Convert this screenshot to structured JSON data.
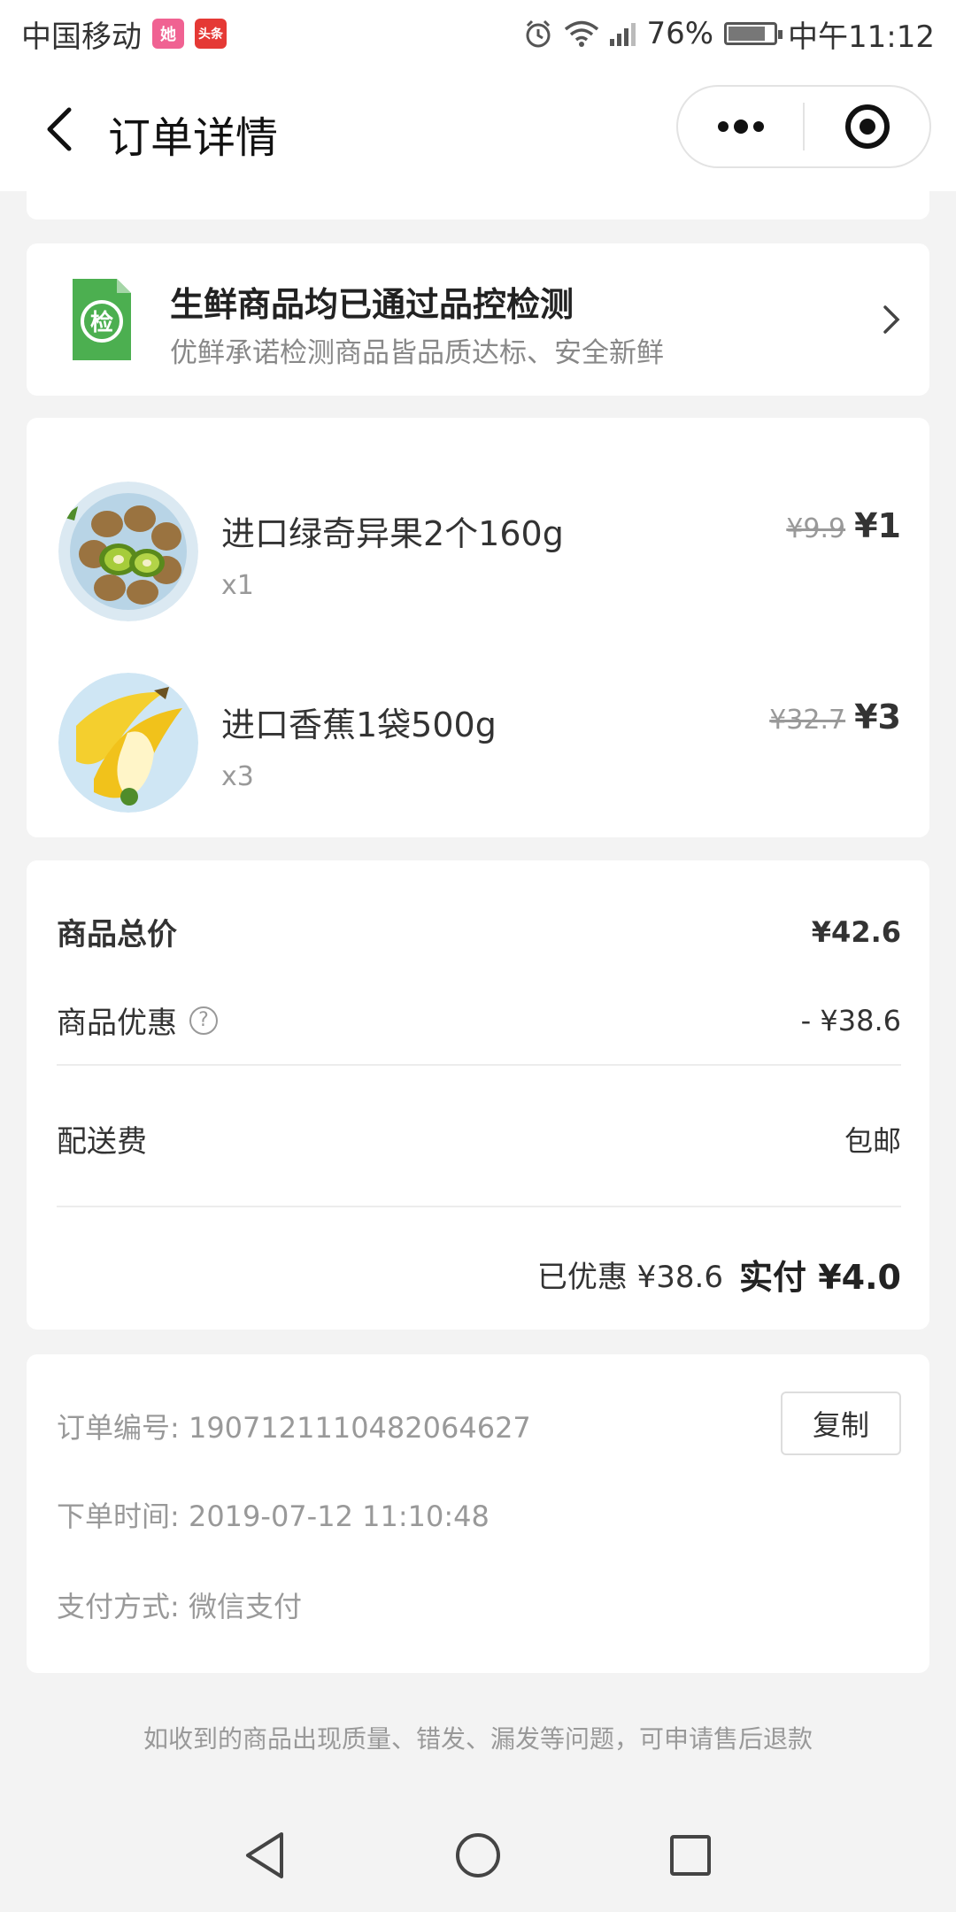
{
  "status_bar": {
    "carrier": "中国移动",
    "badge1": "她",
    "badge2": "头条",
    "battery": "76%",
    "time": "中午11:12",
    "battery_level": 0.76
  },
  "nav": {
    "title": "订单详情"
  },
  "qc_banner": {
    "icon_text": "检",
    "title": "生鲜商品均已通过品控检测",
    "subtitle": "优鲜承诺检测商品皆品质达标、安全新鲜"
  },
  "items": [
    {
      "name": "进口绿奇异果2个160g",
      "qty": "x1",
      "original_price": "¥9.9",
      "price": "¥1",
      "image": "kiwi-image"
    },
    {
      "name": "进口香蕉1袋500g",
      "qty": "x3",
      "original_price": "¥32.7",
      "price": "¥3",
      "image": "banana-image"
    }
  ],
  "summary": {
    "goods_total_label": "商品总价",
    "goods_total_value": "¥42.6",
    "discount_label": "商品优惠",
    "discount_help": "?",
    "discount_value": "- ¥38.6",
    "shipping_label": "配送费",
    "shipping_value": "包邮",
    "saved_text": "已优惠 ¥38.6",
    "paid_text": "实付 ¥4.0"
  },
  "order_info": {
    "order_no": "订单编号: 1907121110482064627",
    "copy_label": "复制",
    "order_time": "下单时间: 2019-07-12 11:10:48",
    "pay_method": "支付方式: 微信支付"
  },
  "footer_note": "如收到的商品出现质量、错发、漏发等问题，可申请售后退款",
  "colors": {
    "qc_green": "#4caf50",
    "badge1": "#f06292",
    "badge2": "#e53935"
  }
}
